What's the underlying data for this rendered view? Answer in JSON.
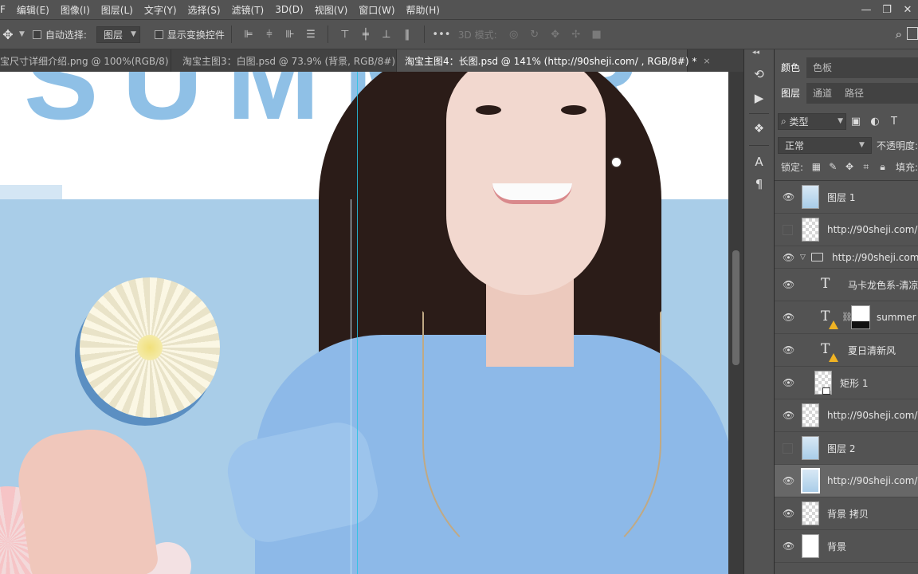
{
  "menubar": {
    "items": [
      "F",
      "编辑(E)",
      "图像(I)",
      "图层(L)",
      "文字(Y)",
      "选择(S)",
      "滤镜(T)",
      "3D(D)",
      "视图(V)",
      "窗口(W)",
      "帮助(H)"
    ],
    "window_controls": [
      "—",
      "❐",
      "✕"
    ]
  },
  "options": {
    "auto_select_label": "自动选择:",
    "auto_select_target": "图层",
    "show_transform_label": "显示变换控件",
    "mode_3d_label": "3D 模式:"
  },
  "tabs": [
    {
      "label": "宝尺寸详细介绍.png @ 100%(RGB/8)",
      "close": "×"
    },
    {
      "label": "淘宝主图3：白图.psd @ 73.9% (背景, RGB/8#)",
      "close": "×"
    },
    {
      "label": "淘宝主图4：长图.psd @ 141% (http://90sheji.com/ , RGB/8#) *",
      "close": "×"
    }
  ],
  "active_tab_index": 2,
  "canvas": {
    "headline_text": "SUMMER",
    "guide_color": "#27c3e4",
    "background_blue": "#a9cde8"
  },
  "panels": {
    "top_tabs": [
      "颜色",
      "色板"
    ],
    "layer_tabs": [
      "图层",
      "通道",
      "路径"
    ],
    "filter_kind": "类型",
    "blend_mode": "正常",
    "opacity_label": "不透明度:",
    "lock_label": "锁定:",
    "fill_label": "填充:"
  },
  "layers": [
    {
      "name": "图层 1",
      "visible": true,
      "kind": "photo"
    },
    {
      "name": "http://90sheji.com/",
      "visible": false,
      "kind": "pixel"
    },
    {
      "name": "http://90sheji.com/",
      "visible": true,
      "kind": "group"
    },
    {
      "name": "马卡龙色系-清凉",
      "visible": true,
      "kind": "text"
    },
    {
      "name": "summer",
      "visible": true,
      "kind": "text-mask"
    },
    {
      "name": "夏日清新风",
      "visible": true,
      "kind": "text-warn"
    },
    {
      "name": "矩形 1",
      "visible": true,
      "kind": "shape"
    },
    {
      "name": "http://90sheji.com/",
      "visible": true,
      "kind": "pixel"
    },
    {
      "name": "图层 2",
      "visible": false,
      "kind": "photo"
    },
    {
      "name": "http://90sheji.com/",
      "visible": true,
      "kind": "selected"
    },
    {
      "name": "背景 拷贝",
      "visible": true,
      "kind": "pixel"
    },
    {
      "name": "背景",
      "visible": true,
      "kind": "white"
    }
  ]
}
